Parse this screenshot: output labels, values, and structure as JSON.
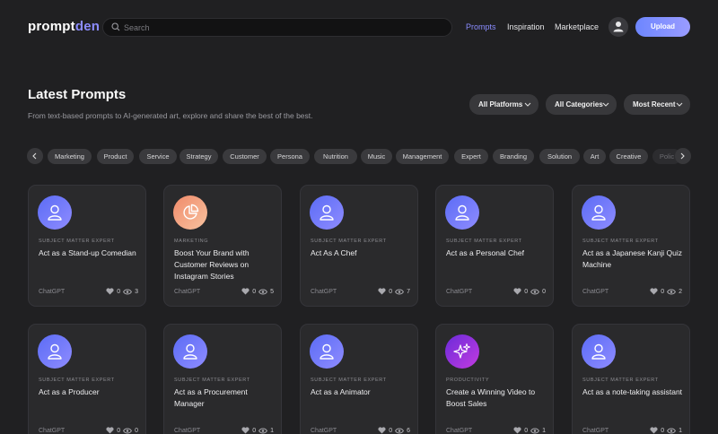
{
  "brand": {
    "part1": "prompt",
    "part2": "den"
  },
  "search": {
    "placeholder": "Search"
  },
  "nav": {
    "prompts": "Prompts",
    "inspiration": "Inspiration",
    "marketplace": "Marketplace"
  },
  "upload_label": "Upload",
  "header": {
    "title": "Latest Prompts",
    "subtitle": "From text-based prompts to AI-generated art, explore and share the best of the best."
  },
  "filters": {
    "platforms": "All Platforms",
    "categories": "All Categories",
    "sort": "Most Recent"
  },
  "chips": [
    "Marketing",
    "Product",
    "Service",
    "Strategy",
    "Customer",
    "Persona",
    "Nutrition",
    "Music",
    "Management",
    "Expert",
    "Branding",
    "Solution",
    "Art",
    "Creative",
    "Polic"
  ],
  "cards": [
    {
      "category": "SUBJECT MATTER EXPERT",
      "title": "Act as a Stand-up Comedian",
      "platform": "ChatGPT",
      "likes": "0",
      "views": "3",
      "icon": "user-icon"
    },
    {
      "category": "MARKETING",
      "title": "Boost Your Brand with Customer Reviews on Instagram Stories",
      "platform": "ChatGPT",
      "likes": "0",
      "views": "5",
      "icon": "pie-chart-icon"
    },
    {
      "category": "SUBJECT MATTER EXPERT",
      "title": "Act As A Chef",
      "platform": "ChatGPT",
      "likes": "0",
      "views": "7",
      "icon": "user-icon"
    },
    {
      "category": "SUBJECT MATTER EXPERT",
      "title": "Act as a Personal Chef",
      "platform": "ChatGPT",
      "likes": "0",
      "views": "0",
      "icon": "user-icon"
    },
    {
      "category": "SUBJECT MATTER EXPERT",
      "title": "Act as a Japanese Kanji Quiz Machine",
      "platform": "ChatGPT",
      "likes": "0",
      "views": "2",
      "icon": "user-icon"
    },
    {
      "category": "SUBJECT MATTER EXPERT",
      "title": "Act as a Producer",
      "platform": "ChatGPT",
      "likes": "0",
      "views": "0",
      "icon": "user-icon"
    },
    {
      "category": "SUBJECT MATTER EXPERT",
      "title": "Act as a Procurement Manager",
      "platform": "ChatGPT",
      "likes": "0",
      "views": "1",
      "icon": "user-icon"
    },
    {
      "category": "SUBJECT MATTER EXPERT",
      "title": "Act as a Animator",
      "platform": "ChatGPT",
      "likes": "0",
      "views": "6",
      "icon": "user-icon"
    },
    {
      "category": "PRODUCTIVITY",
      "title": "Create a Winning Video to Boost Sales",
      "platform": "ChatGPT",
      "likes": "0",
      "views": "1",
      "icon": "sparkles-icon"
    },
    {
      "category": "SUBJECT MATTER EXPERT",
      "title": "Act as a note-taking assistant",
      "platform": "ChatGPT",
      "likes": "0",
      "views": "1",
      "icon": "user-icon"
    }
  ],
  "colors": {
    "accent": "#8a8cff",
    "background": "#202022",
    "card": "#2a2a2c"
  }
}
